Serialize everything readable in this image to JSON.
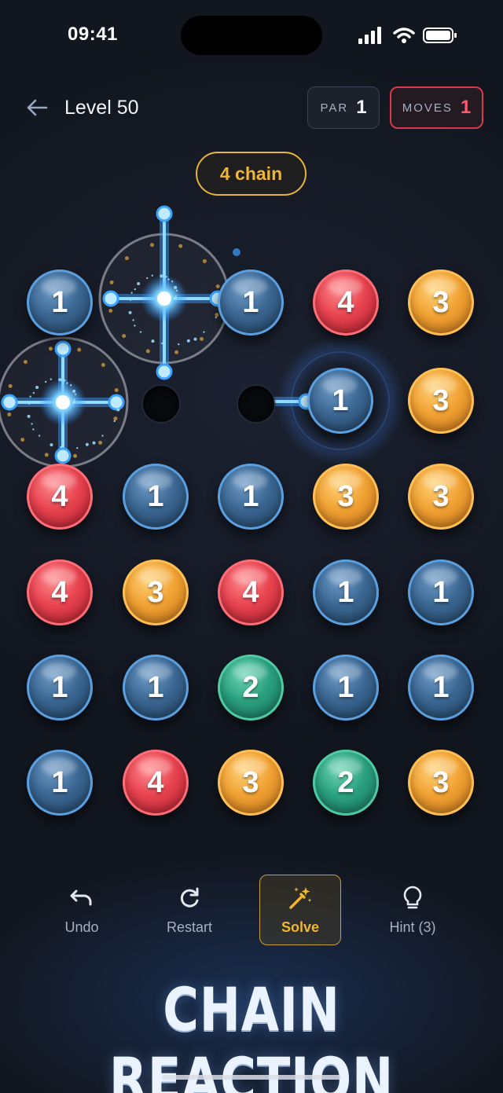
{
  "status_bar": {
    "time": "09:41"
  },
  "header": {
    "level_label": "Level 50",
    "par_label": "PAR",
    "par_value": "1",
    "moves_label": "MOVES",
    "moves_value": "1"
  },
  "chain_badge": "4 chain",
  "board": {
    "rows": [
      [
        "1",
        "burst",
        "1",
        "4",
        "3"
      ],
      [
        "burst",
        "empty",
        "empty",
        "1",
        "3"
      ],
      [
        "4",
        "1",
        "1",
        "3",
        "3"
      ],
      [
        "4",
        "3",
        "4",
        "1",
        "1"
      ],
      [
        "1",
        "1",
        "2",
        "1",
        "1"
      ],
      [
        "1",
        "4",
        "3",
        "2",
        "3"
      ]
    ],
    "colors": {
      "1": "#3b6793",
      "2": "#2aa17e",
      "3": "#f1a233",
      "4": "#e8434f"
    }
  },
  "toolbar": {
    "undo": "Undo",
    "restart": "Restart",
    "solve": "Solve",
    "hint": "Hint (3)"
  },
  "banner": "CHAIN REACTION"
}
